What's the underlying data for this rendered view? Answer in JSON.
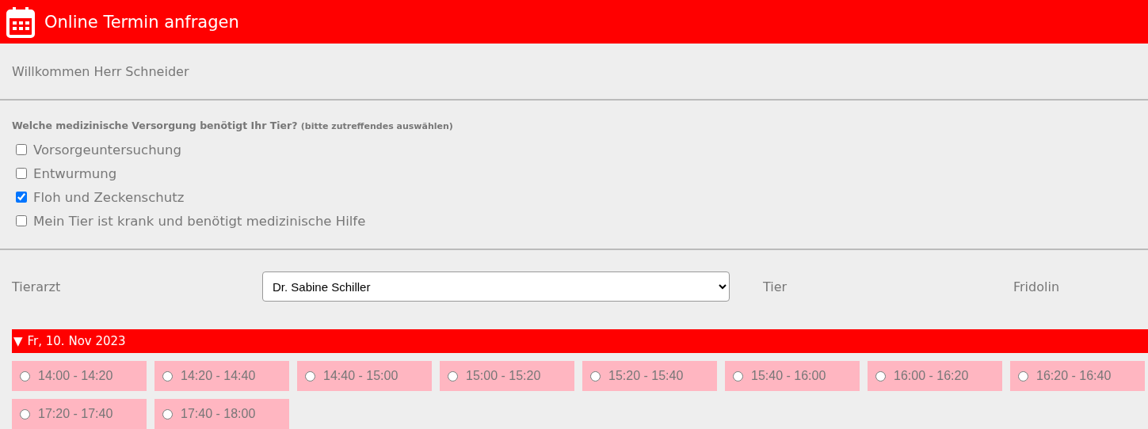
{
  "header": {
    "title": "Online Termin anfragen"
  },
  "welcome": "Willkommen Herr Schneider",
  "care": {
    "question": "Welche medizinische Versorgung benötigt Ihr Tier?",
    "hint": "(bitte zutreffendes auswählen)",
    "options": [
      {
        "label": "Vorsorgeuntersuchung",
        "checked": false
      },
      {
        "label": "Entwurmung",
        "checked": false
      },
      {
        "label": "Floh und Zeckenschutz",
        "checked": true
      },
      {
        "label": "Mein Tier ist krank und benötigt medizinische Hilfe",
        "checked": false
      }
    ]
  },
  "vet": {
    "label": "Tierarzt",
    "value": "Dr. Sabine Schiller"
  },
  "animal": {
    "label": "Tier",
    "value": "Fridolin"
  },
  "day": {
    "toggle": "▼",
    "date": "Fr, 10. Nov 2023"
  },
  "slots": [
    {
      "label": "14:00 - 14:20",
      "selected": false
    },
    {
      "label": "14:20 - 14:40",
      "selected": false
    },
    {
      "label": "14:40 - 15:00",
      "selected": false
    },
    {
      "label": "15:00 - 15:20",
      "selected": false
    },
    {
      "label": "15:20 - 15:40",
      "selected": false
    },
    {
      "label": "15:40 - 16:00",
      "selected": false
    },
    {
      "label": "16:00 - 16:20",
      "selected": false
    },
    {
      "label": "16:20 - 16:40",
      "selected": false
    },
    {
      "label": "17:20 - 17:40",
      "selected": false
    },
    {
      "label": "17:40 - 18:00",
      "selected": false
    }
  ]
}
